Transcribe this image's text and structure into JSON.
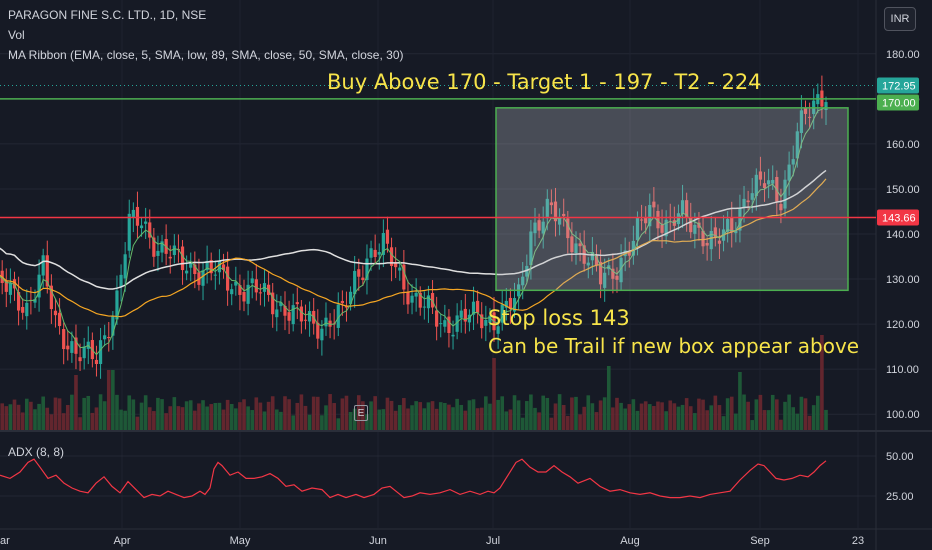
{
  "header": {
    "symbol_line": "PARAGON FINE S.C. LTD., 1D, NSE",
    "vol_label": "Vol",
    "ma_ribbon_label": "MA Ribbon (EMA, close, 5, SMA, low, 89, SMA, close, 50, SMA, close, 30)",
    "currency_button": "INR"
  },
  "annotations": {
    "buy_text": "Buy Above 170 - Target 1 - 197 - T2 - 224",
    "stop_loss": "Stop loss 143",
    "trail_text": "Can be Trail if new box appear above"
  },
  "earnings_marker": "E",
  "adx_label": "ADX (8, 8)",
  "colors": {
    "background": "#161a25",
    "up": "#26a69a",
    "down": "#ef5350",
    "annotation_text": "#f7e44a",
    "resistance_line": "#4caf50",
    "support_line": "#f23645",
    "box_border": "#4caf50",
    "ema5": "#66bb6a",
    "sma30": "#e0e0e0",
    "sma50": "#f5a623",
    "adx": "#f23645"
  },
  "chart_data": [
    {
      "type": "candlestick",
      "price_axis": {
        "ticks": [
          100,
          110,
          120,
          130,
          140,
          150,
          160,
          170,
          180
        ],
        "ylim": [
          96.5,
          183.5
        ]
      },
      "time_axis_labels": [
        "Apr",
        "May",
        "Jun",
        "Jul",
        "Aug",
        "Sep",
        "23"
      ],
      "price_labels": [
        {
          "value": 172.95,
          "text": "172.95",
          "color": "#26a69a"
        },
        {
          "value": 170.0,
          "text": "170.00",
          "color": "#4caf50"
        },
        {
          "value": 143.66,
          "text": "143.66",
          "color": "#f23645"
        }
      ],
      "horizontal_lines": [
        {
          "value": 170.0,
          "color": "#4caf50"
        },
        {
          "value": 143.66,
          "color": "#f23645"
        }
      ],
      "box": {
        "from": "Jul",
        "price_top": 168,
        "price_bottom": 127.5
      },
      "key_levels": {
        "entry": 170,
        "target_1": 197,
        "target_2": 224,
        "stop_loss": 143
      },
      "grid": true
    },
    {
      "type": "line",
      "name": "ADX (8, 8)",
      "y_ticks": [
        25,
        50
      ],
      "ylim": [
        5,
        65
      ],
      "grid": true
    }
  ]
}
